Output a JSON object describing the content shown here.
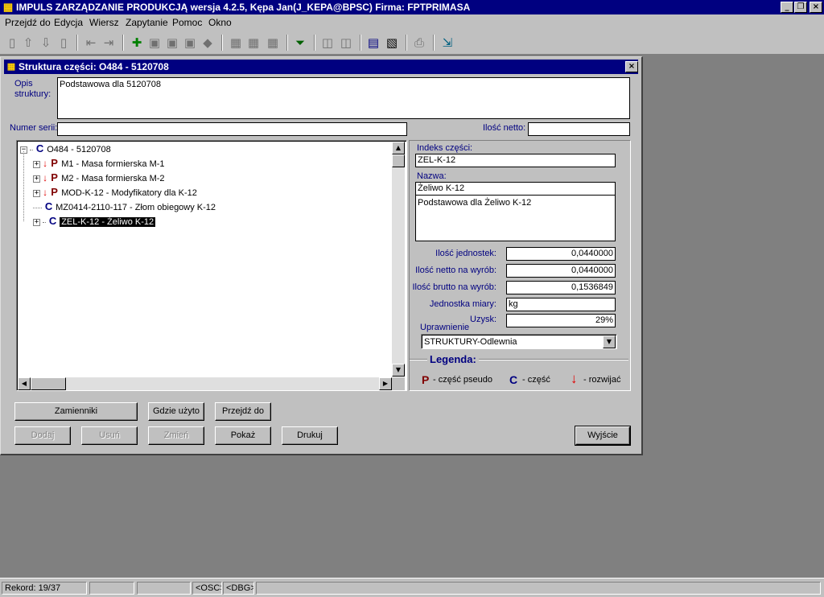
{
  "app": {
    "title": "IMPULS ZARZĄDZANIE PRODUKCJĄ wersja 4.2.5, Kępa Jan(J_KEPA@BPSC) Firma: FPTPRIMASA"
  },
  "window_controls": {
    "minimize": "_",
    "restore": "❐",
    "close": "×"
  },
  "menu": [
    "Przejdź do",
    "Edycja",
    "Wiersz",
    "Zapytanie",
    "Pomoc",
    "Okno"
  ],
  "toolbar_icons": [
    "record-new-icon",
    "arrow-up-icon",
    "arrow-down-icon",
    "record-refresh-icon",
    "first-record-icon",
    "last-record-icon",
    "insert-icon",
    "copy-record-icon",
    "paste-record-icon",
    "edit-record-icon",
    "delete-record-icon",
    "query-icon",
    "query-run-icon",
    "query-cancel-icon",
    "filter-icon",
    "tree-expand-icon",
    "tree-collapse-icon",
    "report-icon",
    "print-preview-icon",
    "print-icon",
    "exit-door-icon"
  ],
  "dialog": {
    "title": "Struktura części: O484 - 5120708",
    "close": "×",
    "opis_label_1": "Opis",
    "opis_label_2": "struktury:",
    "opis_value": "Podstawowa dla 5120708",
    "numer_serii_label": "Numer serii:",
    "numer_serii_value": "",
    "ilosc_netto_label": "Ilość netto:",
    "ilosc_netto_value": ""
  },
  "tree": {
    "root": {
      "letter": "C",
      "label": "O484 - 5120708",
      "expander": "−"
    },
    "children": [
      {
        "expander": "+",
        "arrow": "↓",
        "letter": "P",
        "label": "M1 - Masa formierska M-1"
      },
      {
        "expander": "+",
        "arrow": "↓",
        "letter": "P",
        "label": "M2 - Masa formierska M-2"
      },
      {
        "expander": "+",
        "arrow": "↓",
        "letter": "P",
        "label": "MOD-K-12 - Modyfikatory dla K-12"
      },
      {
        "expander": "",
        "arrow": "",
        "letter": "C",
        "label": "MZ0414-2110-117 - Złom obiegowy K-12"
      },
      {
        "expander": "+",
        "arrow": "",
        "letter": "C",
        "label": "ZEL-K-12 - Żeliwo K-12",
        "selected": true
      }
    ]
  },
  "scroll_arrows": {
    "up": "▲",
    "down": "▼",
    "left": "◀",
    "right": "▶"
  },
  "detail": {
    "indeks_label": "Indeks części:",
    "indeks_value": "ZEL-K-12",
    "nazwa_label": "Nazwa:",
    "nazwa_value": "Żeliwo K-12",
    "opis_value": "Podstawowa dla Żeliwo K-12",
    "ilosc_jednostek_label": "Ilość jednostek:",
    "ilosc_jednostek_value": "0,0440000",
    "ilosc_netto_wyrob_label": "Ilość netto na wyrób:",
    "ilosc_netto_wyrob_value": "0,0440000",
    "ilosc_brutto_wyrob_label": "Ilość brutto na wyrób:",
    "ilosc_brutto_wyrob_value": "0,1536849",
    "jednostka_label": "Jednostka miary:",
    "jednostka_value": "kg",
    "uzysk_label": "Uzysk:",
    "uzysk_value": "29%",
    "uprawnienie_label": "Uprawnienie",
    "uprawnienie_value": "STRUKTURY-Odlewnia"
  },
  "legend": {
    "title": "Legenda:",
    "p_letter": "P",
    "p_text": "- część pseudo",
    "c_letter": "C",
    "c_text": "- część",
    "arrow": "↓",
    "arrow_text": "- rozwijać"
  },
  "buttons": {
    "zamienniki": "Zamienniki",
    "gdzie_uzyto": "Gdzie użyto",
    "przejdz_do": "Przejdź do",
    "dodaj": "Dodaj",
    "usun": "Usuń",
    "zmien": "Zmień",
    "pokaz": "Pokaż",
    "drukuj": "Drukuj",
    "wyjscie": "Wyjście"
  },
  "status": {
    "rekord": "Rekord: 19/37",
    "cell2": "",
    "cell3": "",
    "osc": "<OSC>",
    "dbg": "<DBG>",
    "cell6": ""
  }
}
